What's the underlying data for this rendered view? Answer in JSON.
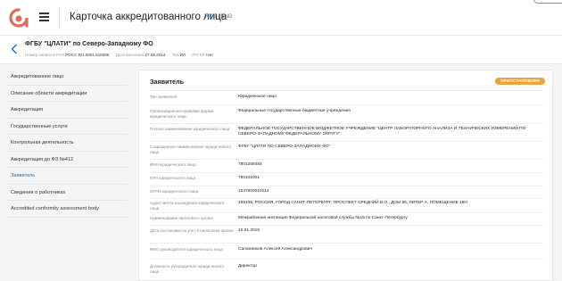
{
  "header": {
    "title": "Карточка аккредитованного лица",
    "lang_ru": "RUS",
    "lang_sep": " | ",
    "lang_en": "ENG",
    "logo_color": "#e06a5a"
  },
  "record": {
    "title": "ФГБУ \"ЦЛАТИ\" по Северо-Западному ФО",
    "meta": [
      {
        "label": "Номер записи в РАЛ",
        "value": "РОСС RU.0001.515006"
      },
      {
        "label": "Дата внесения",
        "value": "27.08.2014"
      },
      {
        "label": "Тип",
        "value": "ИЛ"
      },
      {
        "label": "IPV EP",
        "value": "Нет"
      }
    ]
  },
  "sidebar": {
    "items": [
      {
        "label": "Аккредитованное лицо",
        "active": false
      },
      {
        "label": "Описание области аккредитации",
        "active": false
      },
      {
        "label": "Аккредитация",
        "active": false
      },
      {
        "label": "Государственные услуги",
        "active": false
      },
      {
        "label": "Контрольная деятельность",
        "active": false
      },
      {
        "label": "Аккредитация до ФЗ №412",
        "active": false
      },
      {
        "label": "Заявитель",
        "active": true
      },
      {
        "label": "Сведения о работниках",
        "active": false
      },
      {
        "label": "Accredited conformity assessment body",
        "active": false
      }
    ]
  },
  "main": {
    "title": "Заявитель",
    "status": "ПРИОСТАНОВЛЕН",
    "status_color": "#f0a23a",
    "fields": [
      {
        "label": "Тип заявителя",
        "value": "Юридическое лицо"
      },
      {
        "label": "Организационно-правовая форма юридического лица",
        "value": "Федеральные государственные бюджетные учреждения"
      },
      {
        "label": "Полное наименование юридического лица",
        "value": "ФЕДЕРАЛЬНОЕ ГОСУДАРСТВЕННОЕ БЮДЖЕТНОЕ УЧРЕЖДЕНИЕ \"ЦЕНТР ЛАБОРАТОРНОГО АНАЛИЗА И ТЕХНИЧЕСКИХ ИЗМЕРЕНИЙ ПО СЕВЕРО-ЗАПАДНОМУ ФЕДЕРАЛЬНОМУ ОКРУГУ\""
      },
      {
        "label": "Сокращенное наименование юридического лица",
        "value": "ФГБУ \"ЦЛАТИ ПО СЕВЕРО-ЗАПАДНОМУ ФО\""
      },
      {
        "label": "ИНН юридического лица",
        "value": "7801258484"
      },
      {
        "label": "КПП юридического лица",
        "value": "780101001"
      },
      {
        "label": "ОГРН юридического лица",
        "value": "1047800010114"
      },
      {
        "label": "Адрес места нахождения юридического лица",
        "value": "199106, РОССИЯ, ГОРОД САНКТ-ПЕТЕРБУРГ, ПРОСПЕКТ СРЕДНИЙ В.О., ДОМ 86, ЛИТЕР А, ПОМЕЩЕНИЕ 18Н"
      },
      {
        "label": "Наименование налогового органа",
        "value": "Межрайонная инспекция Федеральной налоговой службы №15 по Санкт-Петербургу"
      },
      {
        "label": "Дата постановки на учет в налоговом органе",
        "value": "10.01.2015"
      },
      {
        "label": "ФИО руководителя юридического лица",
        "value": "Сапожников Алексей Александрович"
      },
      {
        "label": "Должность руководителя юридического лица",
        "value": "Директор"
      }
    ]
  }
}
